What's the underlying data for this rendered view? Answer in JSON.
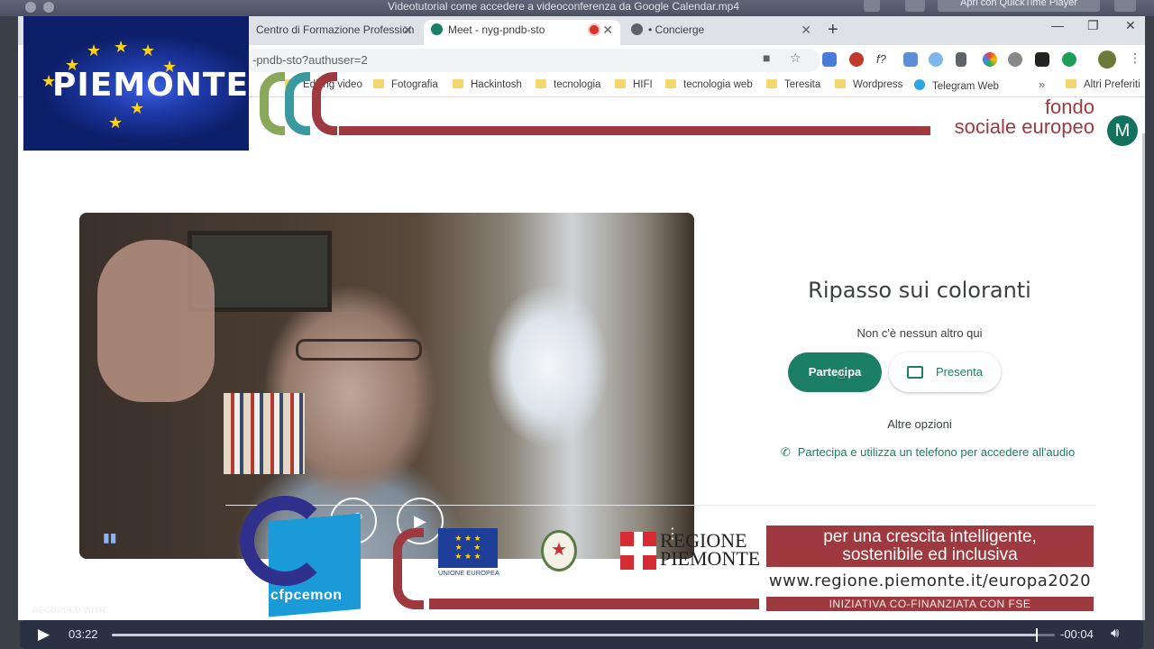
{
  "player": {
    "window_title": "Videotutorial come accedere a videoconferenza da Google Calendar.mp4",
    "open_with": "Apri con QuickTime Player",
    "elapsed": "03:22",
    "remaining": "-00:04",
    "progress_fraction": 0.98,
    "recorded_label": "RECORDED WITH"
  },
  "browser": {
    "tabs": [
      {
        "label": "Centro di Formazione Profession",
        "active": false
      },
      {
        "label": "Meet - nyg-pndb-sto",
        "active": true
      },
      {
        "label": "• Concierge",
        "active": false
      }
    ],
    "url": "-pndb-sto?authuser=2",
    "bookmarks": [
      "Editing video",
      "Fotografia",
      "Hackintosh",
      "tecnologia",
      "HIFI",
      "tecnologia web",
      "Teresita",
      "Wordpress",
      "Telegram Web"
    ],
    "bookmarks_more": "Altri Preferiti",
    "avatar_initial": "M"
  },
  "meet": {
    "meeting_title": "Ripasso sui coloranti",
    "status": "Non c'è nessun altro qui",
    "join_label": "Partecipa",
    "present_label": "Presenta",
    "more_options": "Altre opzioni",
    "phone_option": "Partecipa e utilizza un telefono per accedere all'audio"
  },
  "overlay": {
    "piemonte_logo": "PIEMONTE",
    "fse_line1": "fondo",
    "fse_line2": "sociale europeo",
    "cfp_name": "cfpcemon",
    "eu_label": "UNIONE EUROPEA",
    "regione_line1": "REGIONE",
    "regione_line2": "PIEMONTE",
    "growth_line1": "per una crescita intelligente,",
    "growth_line2": "sostenibile ed inclusiva",
    "europa_url": "www.regione.piemonte.it/europa2020",
    "cofinanced": "INIZIATIVA CO-FINANZIATA CON FSE"
  },
  "colors": {
    "meet_green": "#1a7f64",
    "fse_red": "#9e3a3f",
    "piemonte_blue": "#1e3aa8"
  },
  "icons": [
    "camera-icon",
    "star-icon",
    "microphone-icon",
    "video-camera-icon",
    "phone-icon",
    "present-screen-icon",
    "play-icon",
    "volume-icon",
    "more-icon"
  ]
}
